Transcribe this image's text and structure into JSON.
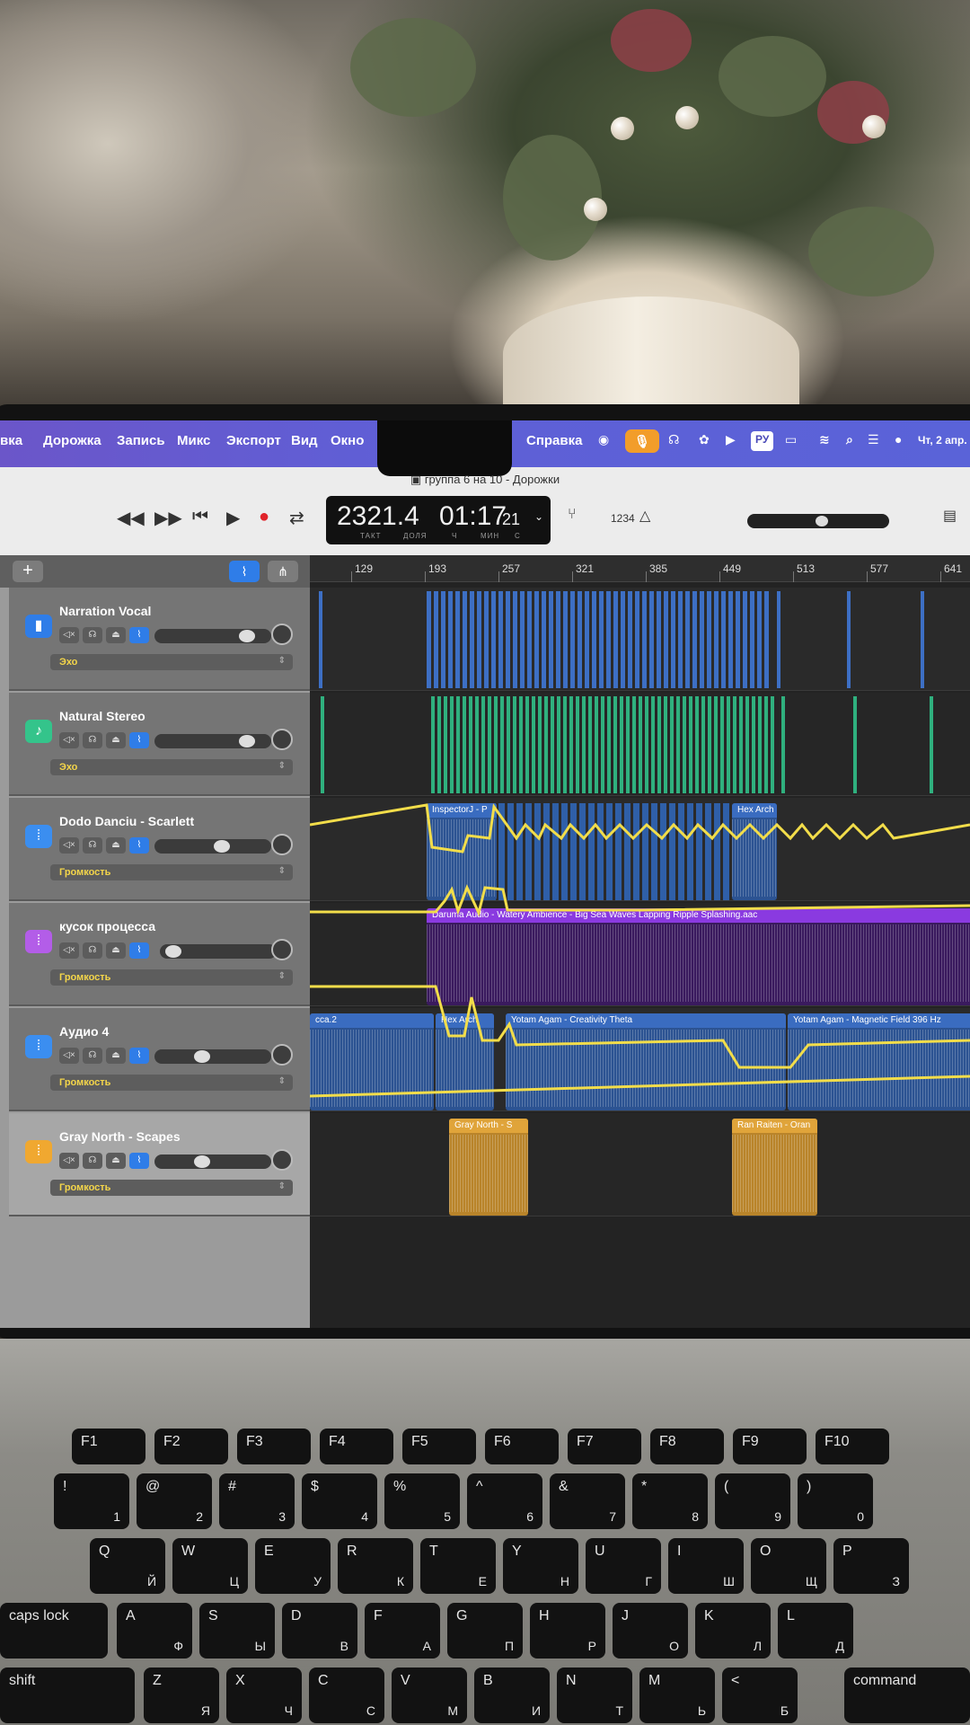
{
  "menubar": {
    "items": [
      "вка",
      "Дорожка",
      "Запись",
      "Микс",
      "Экспорт",
      "Вид",
      "Окно",
      "Справка"
    ],
    "status": {
      "language": "РУ",
      "datetime": "Чт, 2 апр."
    }
  },
  "window": {
    "title": "группа 6 на 10 - Дорожки"
  },
  "transport": {
    "position_bars": "2321.4",
    "time": "01:17",
    "time_seconds_small": "21",
    "label_bar": "ТАКТ",
    "label_beat": "ДОЛЯ",
    "label_h": "Ч",
    "label_min": "МИН",
    "label_s": "С",
    "counter_mode": "1234"
  },
  "panel": {
    "add_label": "+"
  },
  "tracks": [
    {
      "name": "Narration Vocal",
      "param": "Эхо",
      "icon": "microphone-icon",
      "color": "#2f7de8",
      "volume": 0.85
    },
    {
      "name": "Natural Stereo",
      "param": "Эхо",
      "icon": "guitar-icon",
      "color": "#34c48b",
      "volume": 0.85
    },
    {
      "name": "Dodo Danciu - Scarlett",
      "param": "Громкость",
      "icon": "waveform-icon",
      "color": "#3b8ef0",
      "volume": 0.6
    },
    {
      "name": "кусок процесса",
      "param": "Громкость",
      "icon": "waveform-icon",
      "color": "#b35de8",
      "volume": 0.05
    },
    {
      "name": "Аудио 4",
      "param": "Громкость",
      "icon": "waveform-icon",
      "color": "#3b8ef0",
      "volume": 0.4
    },
    {
      "name": "Gray North - Scapes",
      "param": "Громкость",
      "icon": "waveform-icon",
      "color": "#f0a830",
      "volume": 0.4
    }
  ],
  "ruler": [
    "129",
    "193",
    "257",
    "321",
    "385",
    "449",
    "513",
    "577",
    "641"
  ],
  "regions": {
    "inspector": "InspectorJ - P",
    "hex_arch_1": "Hex Arch",
    "daruma": "Daruma Audio - Watery Ambience - Big Sea Waves Lapping Ripple Splashing.aac",
    "cca2": "cca.2",
    "hex_arch_2": "Hex Arch",
    "yotam1": "Yotam Agam - Creativity Theta",
    "yotam2": "Yotam Agam - Magnetic Field 396 Hz",
    "gray_north": "Gray North - S",
    "ran_raiten": "Ran Raiten - Oran"
  },
  "keyboard": {
    "row_fn": [
      "F1",
      "F2",
      "F3",
      "F4",
      "F5",
      "F6",
      "F7",
      "F8",
      "F9",
      "F10"
    ],
    "row_num": [
      [
        "!",
        "1"
      ],
      [
        "@",
        "2"
      ],
      [
        "#",
        "№",
        "3"
      ],
      [
        "$",
        "%",
        "4"
      ],
      [
        "%",
        ":",
        "5"
      ],
      [
        "^",
        "6"
      ],
      [
        "&",
        "7"
      ],
      [
        "*",
        "8"
      ],
      [
        "(",
        "9"
      ],
      [
        ")",
        "0"
      ]
    ],
    "row_q": [
      [
        "Q",
        "Й"
      ],
      [
        "W",
        "Ц"
      ],
      [
        "E",
        "У"
      ],
      [
        "R",
        "К"
      ],
      [
        "T",
        "Е"
      ],
      [
        "Y",
        "Н"
      ],
      [
        "U",
        "Г"
      ],
      [
        "I",
        "Ш"
      ],
      [
        "O",
        "Щ"
      ],
      [
        "P",
        "З"
      ]
    ],
    "row_a": [
      [
        "A",
        "Ф"
      ],
      [
        "S",
        "Ы"
      ],
      [
        "D",
        "В"
      ],
      [
        "F",
        "А"
      ],
      [
        "G",
        "П"
      ],
      [
        "H",
        "Р"
      ],
      [
        "J",
        "О"
      ],
      [
        "K",
        "Л"
      ],
      [
        "L",
        "Д"
      ]
    ],
    "row_z": [
      [
        "Z",
        "Я"
      ],
      [
        "X",
        "Ч"
      ],
      [
        "C",
        "С"
      ],
      [
        "V",
        "М"
      ],
      [
        "B",
        "И"
      ],
      [
        "N",
        "Т"
      ],
      [
        "M",
        "Ь"
      ],
      [
        "<",
        "Б"
      ]
    ],
    "caps": "caps lock",
    "shift": "shift",
    "command": "command"
  }
}
